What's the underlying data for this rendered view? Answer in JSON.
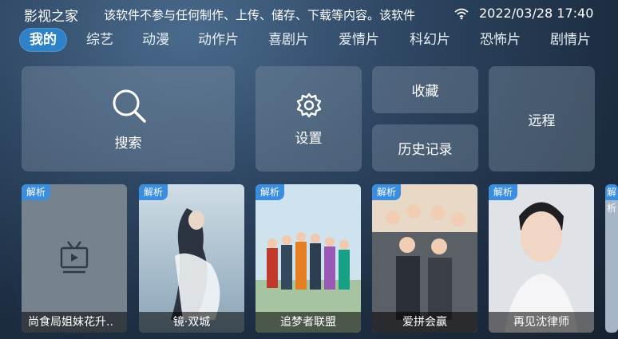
{
  "header": {
    "app_title": "影视之家",
    "notice": "该软件不参与任何制作、上传、储存、下载等内容。该软件",
    "datetime": "2022/03/28 17:40",
    "wifi_icon": "wifi-icon"
  },
  "tabs": [
    {
      "label": "我的",
      "active": true
    },
    {
      "label": "综艺"
    },
    {
      "label": "动漫"
    },
    {
      "label": "动作片"
    },
    {
      "label": "喜剧片"
    },
    {
      "label": "爱情片"
    },
    {
      "label": "科幻片"
    },
    {
      "label": "恐怖片"
    },
    {
      "label": "剧情片"
    }
  ],
  "actions": {
    "search": {
      "label": "搜索",
      "icon": "search-icon"
    },
    "settings": {
      "label": "设置",
      "icon": "gear-icon"
    },
    "favorites": {
      "label": "收藏"
    },
    "remote": {
      "label": "远程"
    },
    "history": {
      "label": "历史记录"
    }
  },
  "posters": [
    {
      "badge": "解析",
      "title": "尚食局姐妹花升.."
    },
    {
      "badge": "解析",
      "title": "镜·双城"
    },
    {
      "badge": "解析",
      "title": "追梦者联盟"
    },
    {
      "badge": "解析",
      "title": "爱拼会赢"
    },
    {
      "badge": "解析",
      "title": "再见沈律师"
    },
    {
      "badge": "解析",
      "title": ""
    }
  ],
  "colors": {
    "active_tab": "#2e82c8",
    "badge": "#3b8de0",
    "tile": "#7d8ea2"
  }
}
